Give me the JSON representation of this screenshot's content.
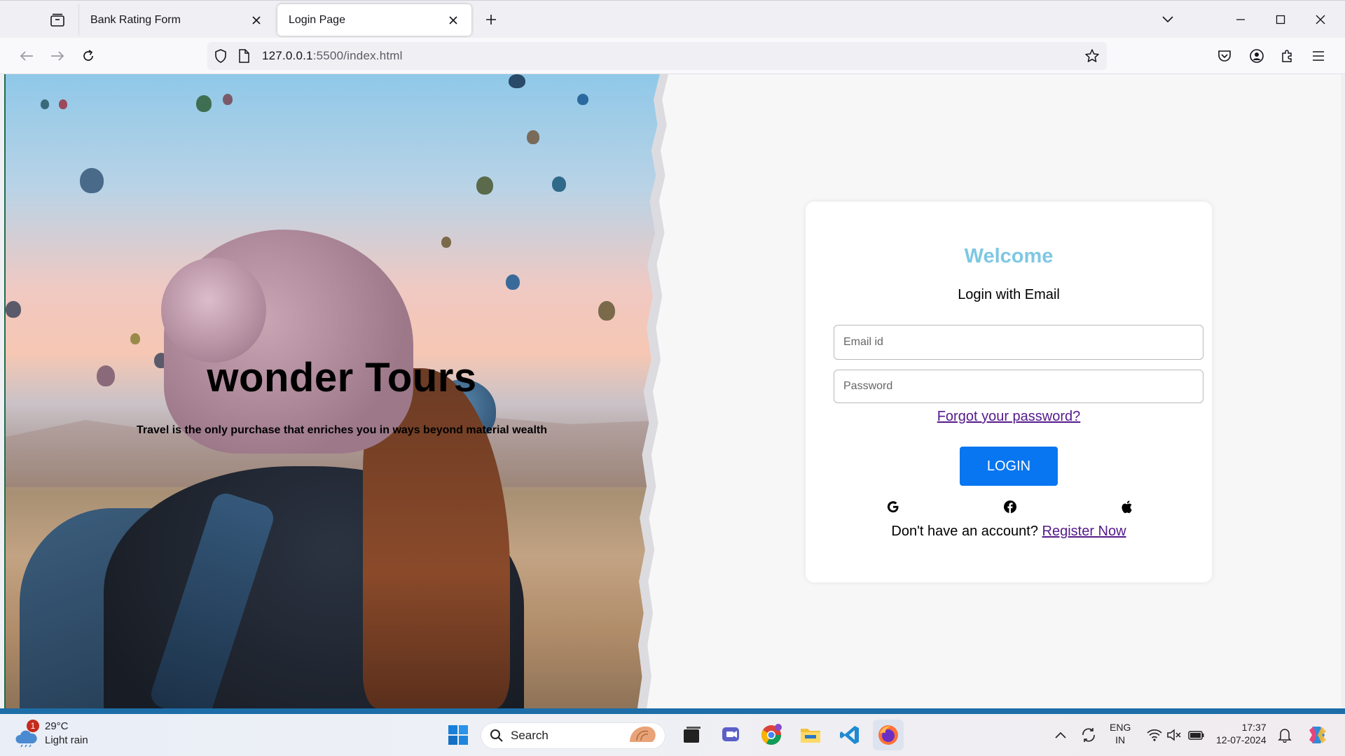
{
  "browser": {
    "tabs": [
      {
        "title": "Bank Rating Form",
        "active": false
      },
      {
        "title": "Login Page",
        "active": true
      }
    ],
    "url_host": "127.0.0.1",
    "url_rest": ":5500/index.html"
  },
  "hero": {
    "title": "wonder Tours",
    "tagline": "Travel is the only purchase that enriches you in ways beyond material wealth"
  },
  "login": {
    "heading": "Welcome",
    "subtitle": "Login with Email",
    "email_placeholder": "Email id",
    "password_placeholder": "Password",
    "forgot_link": "Forgot your password?",
    "login_button": "LOGIN",
    "social_icons": [
      "google-icon",
      "facebook-icon",
      "apple-icon"
    ],
    "register_prompt": "Don't have an account?",
    "register_link": "Register Now"
  },
  "colors": {
    "accent_welcome": "#7ec8e3",
    "login_button": "#0776f0",
    "link_visited": "#551a8b"
  },
  "taskbar": {
    "weather_temp": "29°C",
    "weather_desc": "Light rain",
    "weather_badge": "1",
    "search_label": "Search",
    "lang_top": "ENG",
    "lang_bottom": "IN",
    "time": "17:37",
    "date": "12-07-2024"
  }
}
